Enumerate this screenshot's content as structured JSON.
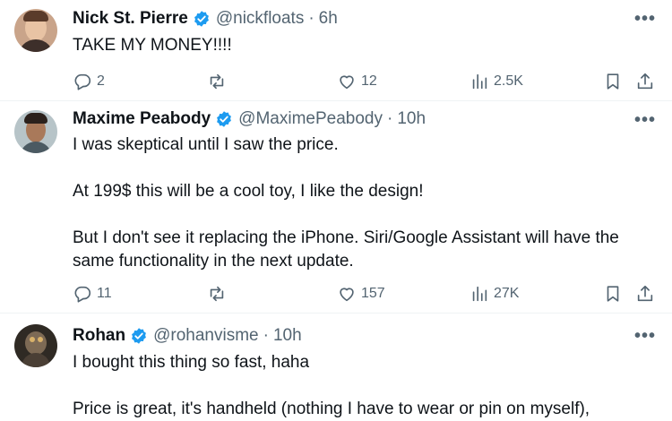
{
  "tweets": [
    {
      "name": "Nick St. Pierre",
      "handle": "@nickfloats",
      "time": "6h",
      "lines": [
        "TAKE MY MONEY!!!!"
      ],
      "replies": "2",
      "retweets": "",
      "likes": "12",
      "views": "2.5K",
      "more": "•••"
    },
    {
      "name": "Maxime Peabody",
      "handle": "@MaximePeabody",
      "time": "10h",
      "lines": [
        "I was skeptical until I saw the price.",
        "At 199$ this will be a cool toy, I like the design!",
        "But I don't see it replacing the iPhone. Siri/Google Assistant will have the",
        "same functionality in the next update."
      ],
      "replies": "11",
      "retweets": "",
      "likes": "157",
      "views": "27K",
      "more": "•••"
    },
    {
      "name": "Rohan",
      "handle": "@rohanvisme",
      "time": "10h",
      "lines": [
        "I bought this thing so fast, haha",
        "Price is great, it's handheld (nothing I have to wear or pin on myself),"
      ],
      "more": "•••"
    }
  ],
  "separator": "·",
  "colors": {
    "verified": "#1d9bf0",
    "secondary": "#536471",
    "text": "#0f1419"
  }
}
